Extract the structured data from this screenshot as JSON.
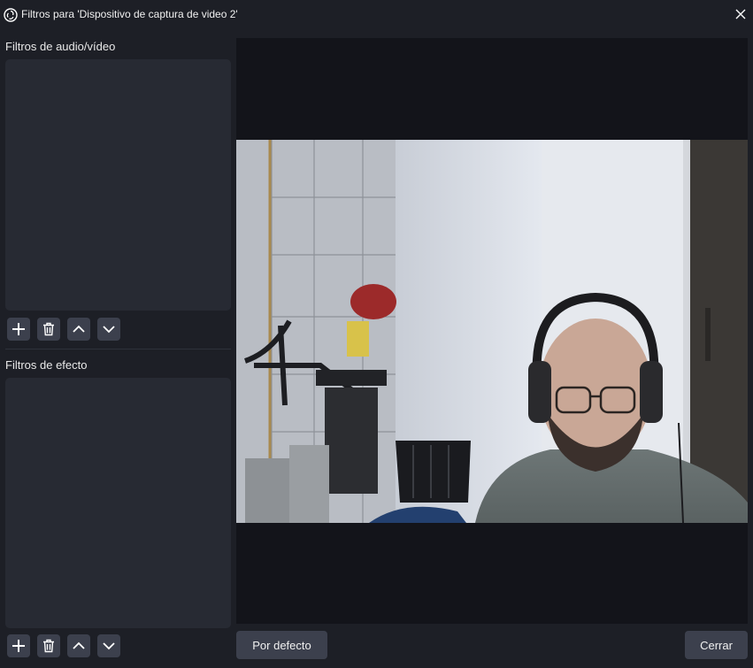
{
  "window": {
    "title": "Filtros para 'Dispositivo de captura de video 2'",
    "app_icon": "obs-logo-icon",
    "close_icon": "close-icon"
  },
  "audio_video_filters": {
    "label": "Filtros de audio/vídeo",
    "items": [],
    "buttons": [
      "add-icon",
      "trash-icon",
      "chevron-up-icon",
      "chevron-down-icon"
    ]
  },
  "effect_filters": {
    "label": "Filtros de efecto",
    "items": [],
    "buttons": [
      "add-icon",
      "trash-icon",
      "chevron-up-icon",
      "chevron-down-icon"
    ]
  },
  "preview": {
    "content": "webcam-video-feed"
  },
  "footer": {
    "defaults_label": "Por defecto",
    "close_label": "Cerrar"
  },
  "colors": {
    "window_bg": "#1d1f26",
    "list_bg": "#272a33",
    "button_bg": "#3c404d",
    "preview_bg": "#13141a"
  }
}
